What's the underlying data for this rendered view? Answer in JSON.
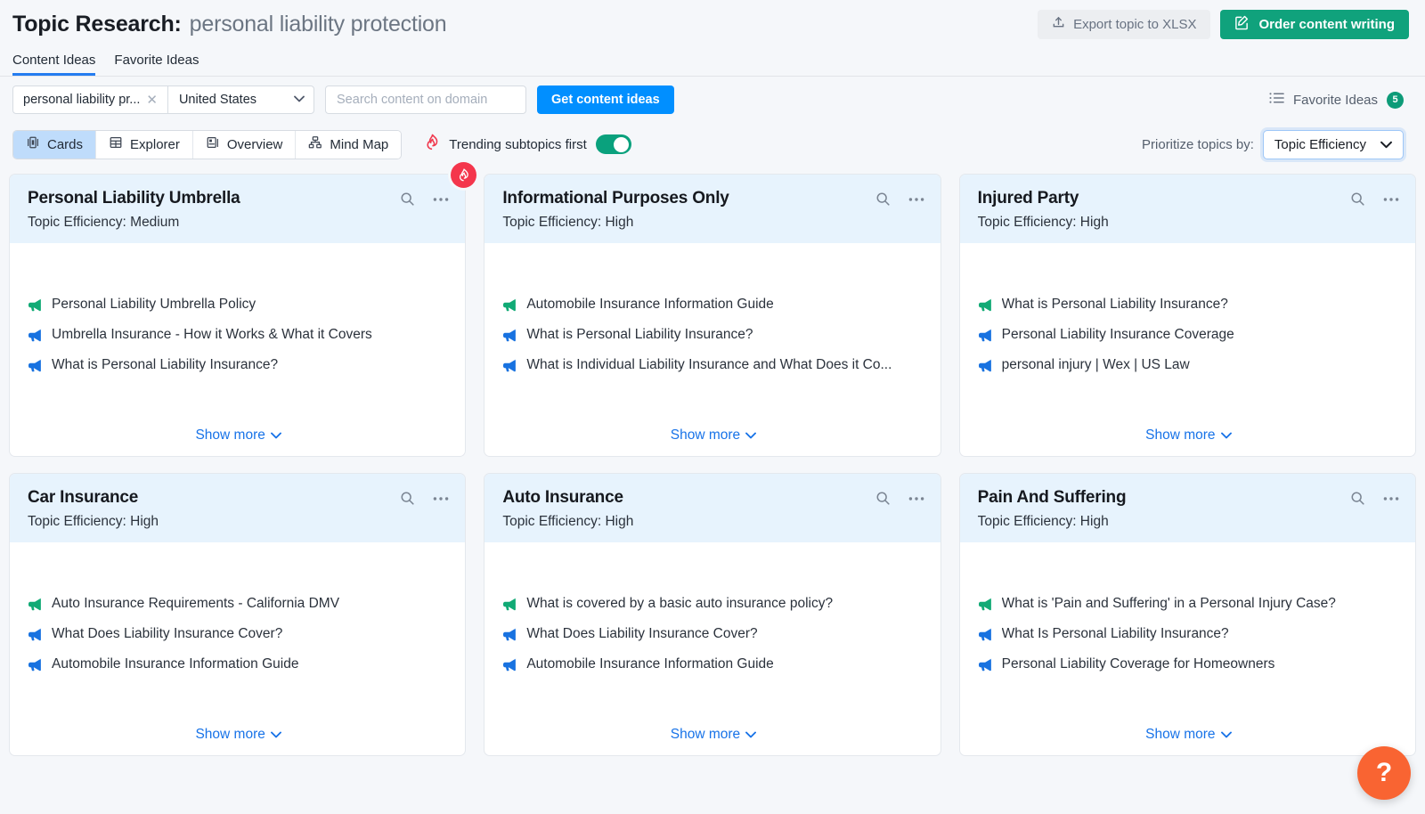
{
  "header": {
    "title": "Topic Research:",
    "term": "personal liability protection",
    "export_label": "Export topic to XLSX",
    "order_label": "Order content writing"
  },
  "tabs": [
    {
      "label": "Content Ideas",
      "active": true
    },
    {
      "label": "Favorite Ideas",
      "active": false
    }
  ],
  "filters": {
    "keyword_value": "personal liability pr...",
    "clear_icon": "close-icon",
    "country_value": "United States",
    "domain_placeholder": "Search content on domain",
    "domain_value": "",
    "get_ideas_label": "Get content ideas",
    "favorite_ideas_label": "Favorite Ideas",
    "favorite_ideas_count": "5"
  },
  "views": {
    "buttons": [
      {
        "label": "Cards",
        "icon": "cards-icon",
        "active": true
      },
      {
        "label": "Explorer",
        "icon": "table-icon",
        "active": false
      },
      {
        "label": "Overview",
        "icon": "overview-icon",
        "active": false
      },
      {
        "label": "Mind Map",
        "icon": "mindmap-icon",
        "active": false
      }
    ],
    "trending_label": "Trending subtopics first",
    "trending_on": true,
    "prioritize_label": "Prioritize topics by:",
    "prioritize_value": "Topic Efficiency"
  },
  "cards": [
    {
      "title": "Personal Liability Umbrella",
      "efficiency": "Topic Efficiency: Medium",
      "trending": true,
      "ideas": [
        "Personal Liability Umbrella Policy",
        "Umbrella Insurance - How it Works & What it Covers",
        "What is Personal Liability Insurance?"
      ],
      "show_more": "Show more"
    },
    {
      "title": "Informational Purposes Only",
      "efficiency": "Topic Efficiency: High",
      "trending": false,
      "ideas": [
        "Automobile Insurance Information Guide",
        "What is Personal Liability Insurance?",
        "What is Individual Liability Insurance and What Does it Co..."
      ],
      "show_more": "Show more"
    },
    {
      "title": "Injured Party",
      "efficiency": "Topic Efficiency: High",
      "trending": false,
      "ideas": [
        "What is Personal Liability Insurance?",
        "Personal Liability Insurance Coverage",
        "personal injury | Wex | US Law"
      ],
      "show_more": "Show more"
    },
    {
      "title": "Car Insurance",
      "efficiency": "Topic Efficiency: High",
      "trending": false,
      "ideas": [
        "Auto Insurance Requirements - California DMV",
        "What Does Liability Insurance Cover?",
        "Automobile Insurance Information Guide"
      ],
      "show_more": "Show more"
    },
    {
      "title": "Auto Insurance",
      "efficiency": "Topic Efficiency: High",
      "trending": false,
      "ideas": [
        "What is covered by a basic auto insurance policy?",
        "What Does Liability Insurance Cover?",
        "Automobile Insurance Information Guide"
      ],
      "show_more": "Show more"
    },
    {
      "title": "Pain And Suffering",
      "efficiency": "Topic Efficiency: High",
      "trending": false,
      "ideas": [
        "What is 'Pain and Suffering' in a Personal Injury Case?",
        "What Is Personal Liability Insurance?",
        "Personal Liability Coverage for Homeowners"
      ],
      "show_more": "Show more"
    }
  ],
  "help": {
    "label": "?"
  },
  "colors": {
    "accent_blue": "#018fff",
    "accent_green": "#10a27c",
    "flame_red": "#f4364c",
    "help_orange": "#f96432",
    "card_header_blue": "#e7f3fd",
    "page_bg": "#f5f7fa"
  }
}
